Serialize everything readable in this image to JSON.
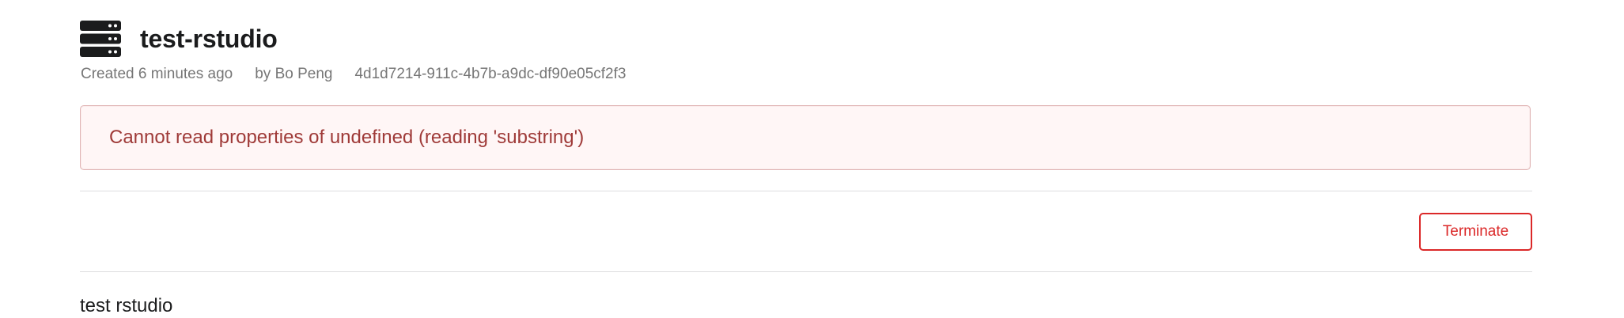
{
  "header": {
    "icon": "server-icon",
    "title": "test-rstudio"
  },
  "meta": {
    "created": "Created 6 minutes ago",
    "author": "by Bo Peng",
    "id": "4d1d7214-911c-4b7b-a9dc-df90e05cf2f3"
  },
  "error": {
    "message": "Cannot read properties of undefined (reading 'substring')",
    "colors": {
      "background": "#fff6f6",
      "border": "#e0b4b4",
      "text": "#9f3a38"
    }
  },
  "actions": {
    "terminate_label": "Terminate",
    "terminate_color": "#db2828"
  },
  "description": "test rstudio"
}
